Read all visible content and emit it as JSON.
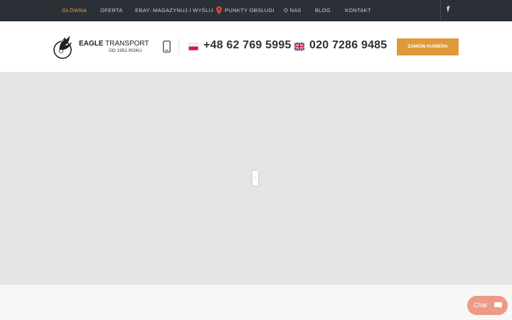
{
  "nav": {
    "items": [
      {
        "label": "GŁÓWNA",
        "active": true
      },
      {
        "label": "OFERTA"
      },
      {
        "label": "EBAY: MAGAZYNUJ I WYŚLIJ"
      },
      {
        "label": "PUNKTY OBSŁUGI",
        "icon": "map-pin-icon"
      },
      {
        "label": "O NAS"
      },
      {
        "label": "BLOG"
      },
      {
        "label": "KONTAKT"
      }
    ],
    "social_icon": "facebook-icon",
    "social_glyph": "f"
  },
  "header": {
    "logo_title_bold": "EAGLE",
    "logo_title_rest": " TRANSPORT",
    "logo_subtitle": "OD 1951 ROKU",
    "phone_pl": "+48 62 769 5995",
    "phone_uk": "020 7286 9485",
    "order_button": "ZAMÓW KURIERA"
  },
  "map": {
    "handle_glyph": "‹"
  },
  "chat": {
    "label": "Chat",
    "icon": "chat-bubble-icon"
  },
  "colors": {
    "topbar": "#2b3036",
    "accent": "#e09a3a",
    "nav_active": "#e0a03b",
    "chat": "#ee9a85"
  }
}
